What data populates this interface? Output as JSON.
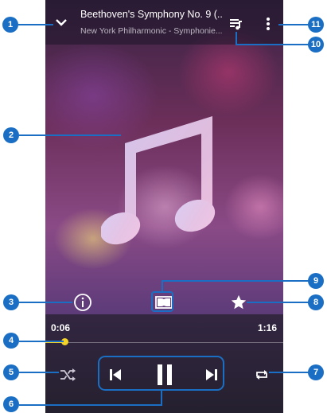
{
  "player": {
    "track_title": "Beethoven's Symphony No. 9 (...",
    "track_subtitle": "New York Philharmonic - Symphonie...",
    "elapsed_time": "0:06",
    "total_time": "1:16",
    "progress_fraction": 0.08
  },
  "icons": {
    "collapse": "chevron-down-icon",
    "queue": "queue-music-icon",
    "menu": "more-vert-icon",
    "album_art": "music-note-icon",
    "info": "info-icon",
    "dolby": "dolby-icon",
    "favorite": "star-icon",
    "shuffle": "shuffle-icon",
    "previous": "skip-previous-icon",
    "pause": "pause-icon",
    "next": "skip-next-icon",
    "repeat": "repeat-icon"
  },
  "callouts": [
    "1",
    "2",
    "3",
    "4",
    "5",
    "6",
    "7",
    "8",
    "9",
    "10",
    "11"
  ],
  "colors": {
    "accent": "#1a6fc4",
    "progress": "#f5d42a",
    "text_primary": "#ffffff",
    "text_secondary": "#bdb6c2"
  }
}
